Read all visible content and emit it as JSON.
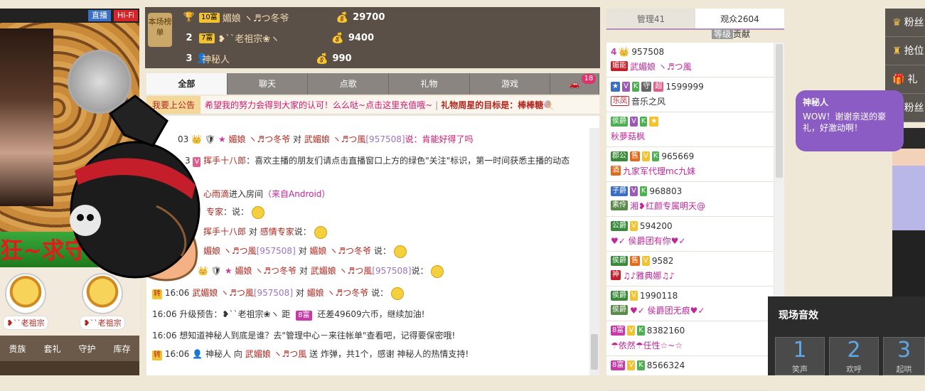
{
  "video": {
    "live_label": "直播",
    "hifi_label": "Hi-Fi",
    "banner_text": "狂~求守护",
    "guards": [
      {
        "name": "❥``老祖宗"
      },
      {
        "name": "❥``老祖宗"
      }
    ],
    "nav": [
      "贵族",
      "套礼",
      "守护",
      "库存"
    ]
  },
  "ranking": {
    "badge": "本场榜单",
    "rows": [
      {
        "rank": "1",
        "level": "10富",
        "name": "媚娘 ヽ♬つ冬爷",
        "value": "29700"
      },
      {
        "rank": "2",
        "level": "7富",
        "name": "❥``老祖宗❀ヽ",
        "value": "9400"
      },
      {
        "rank": "3",
        "level": "",
        "name": "神秘人",
        "value": "990"
      }
    ]
  },
  "tabs": [
    {
      "label": "全部",
      "active": true
    },
    {
      "label": "聊天"
    },
    {
      "label": "点歌"
    },
    {
      "label": "礼物"
    },
    {
      "label": "游戏"
    },
    {
      "label": ""
    }
  ],
  "tab_badge": "18",
  "announcement": {
    "label": "我要上公告",
    "text": "希望我的努力会得到大家的认可！么么哒~点击这里充值哦~",
    "goal": "礼物周星的目标是：棒棒糖"
  },
  "chat": [
    {
      "time": "03",
      "pre": "",
      "from": "媚娘 ヽ♬つ冬爷",
      "mid": "对",
      "to": "武媚娘 ヽ♬つ風",
      "id": "[957508]",
      "msg": "说：肯能好得了吗"
    },
    {
      "time": "3",
      "pre": "",
      "from": "挥手十八郎",
      "mid": "",
      "to": "",
      "id": "",
      "msg": "：喜欢主播的朋友们请点击直播窗口上方的绿色\"关注\"标识，第一时间获悉主播的动态"
    },
    {
      "time": "",
      "pre": "",
      "from": "心雨滴",
      "mid": "进入房间",
      "to": "",
      "id": "",
      "msg": "（来自Android）"
    },
    {
      "time": "",
      "pre": "",
      "from": "专家",
      "mid": "",
      "to": "",
      "id": "",
      "msg": "：说："
    },
    {
      "time": "",
      "pre": "",
      "from": "挥手十八郎",
      "mid": "对",
      "to": "感情专家",
      "id": "",
      "msg": "说："
    },
    {
      "time": "",
      "pre": "",
      "from": "媚娘 ヽ♬つ風",
      "mid": "对",
      "to": "媚娘 ヽ♬つ冬爷",
      "id": "[957508]",
      "msg": "说："
    },
    {
      "time": "",
      "pre": "",
      "from": "媚娘 ヽ♬つ冬爷",
      "mid": "对",
      "to": "武媚娘 ヽ♬つ風",
      "id": "[957508]",
      "msg": "说："
    },
    {
      "time": "16:06",
      "pre": "转",
      "from": "武媚娘 ヽ♬つ風",
      "mid": "对",
      "to": "媚娘 ヽ♬つ冬爷",
      "id": "[957508]",
      "msg": "说："
    },
    {
      "time": "16:06",
      "pre": "",
      "from": "升级预告：❥``老祖宗❀ヽ",
      "mid": "距",
      "to": "8富",
      "id": "",
      "msg": "还差49609六币，继续加油!"
    },
    {
      "time": "16:06",
      "pre": "",
      "from": "",
      "mid": "",
      "to": "",
      "id": "",
      "msg": "想知道神秘人到底是谁？去\"管理中心－来往帐单\"查看吧，记得要保密哦!"
    },
    {
      "time": "16:06",
      "pre": "转",
      "from": "神秘人",
      "mid": "向",
      "to": "武媚娘 ヽ♬つ風",
      "id": "",
      "msg": "送 炸弹，共1个，感谢 神秘人的热情支持!"
    }
  ],
  "users": {
    "tabs": [
      {
        "label": "管理41"
      },
      {
        "label": "观众2604",
        "active": true
      }
    ],
    "sub_level": "等级",
    "sub_contrib": "贡献",
    "list": [
      {
        "badges": [
          "4"
        ],
        "id": "957508",
        "tag": "媚能",
        "name": "武媚娘 ヽ♬つ風"
      },
      {
        "badges": [
          "V",
          "K",
          "守",
          "超"
        ],
        "id": "1599999",
        "tag": "乐凤",
        "name": "音乐之风"
      },
      {
        "badges": [
          "侯爵",
          "V",
          "K",
          "★"
        ],
        "id": "",
        "tag": "",
        "name": "秋夢菇枫"
      },
      {
        "badges": [
          "郡公",
          "售",
          "V",
          "K"
        ],
        "id": "965669",
        "tag": "酒",
        "name": "九家军代理mc九妹"
      },
      {
        "badges": [
          "子爵",
          "V",
          "K"
        ],
        "id": "968803",
        "tag": "素伶",
        "name": "湘❥红颜专属明天@"
      },
      {
        "badges": [
          "公爵",
          "V"
        ],
        "id": "594200",
        "tag": "",
        "name": "♥✓ 侯爵团有你♥✓"
      },
      {
        "badges": [
          "侯爵",
          "售",
          "V"
        ],
        "id": "9582",
        "tag": "神",
        "name": "♫♪雅典娜♫♪"
      },
      {
        "badges": [
          "侯爵",
          "V"
        ],
        "id": "1990118",
        "tag": "侯爵",
        "name": "♥✓ 侯爵团无痕♥✓"
      },
      {
        "badges": [
          "8富",
          "V",
          "K"
        ],
        "id": "8382160",
        "tag": "",
        "name": "☂依然☂任性☆~☆"
      },
      {
        "badges": [
          "8富",
          "V",
          "K"
        ],
        "id": "8566324",
        "tag": "",
        "name": ""
      }
    ]
  },
  "right_menu": [
    "粉丝",
    "抢位",
    "礼物",
    "粉丝"
  ],
  "bubble": {
    "name": "神秘人",
    "text": "WOW！谢谢亲送的豪礼，好激动啊！"
  },
  "sound_panel": {
    "title": "现场音效",
    "buttons": [
      {
        "num": "1",
        "label": "笑声"
      },
      {
        "num": "2",
        "label": "欢呼"
      },
      {
        "num": "3",
        "label": "起哄"
      }
    ]
  }
}
